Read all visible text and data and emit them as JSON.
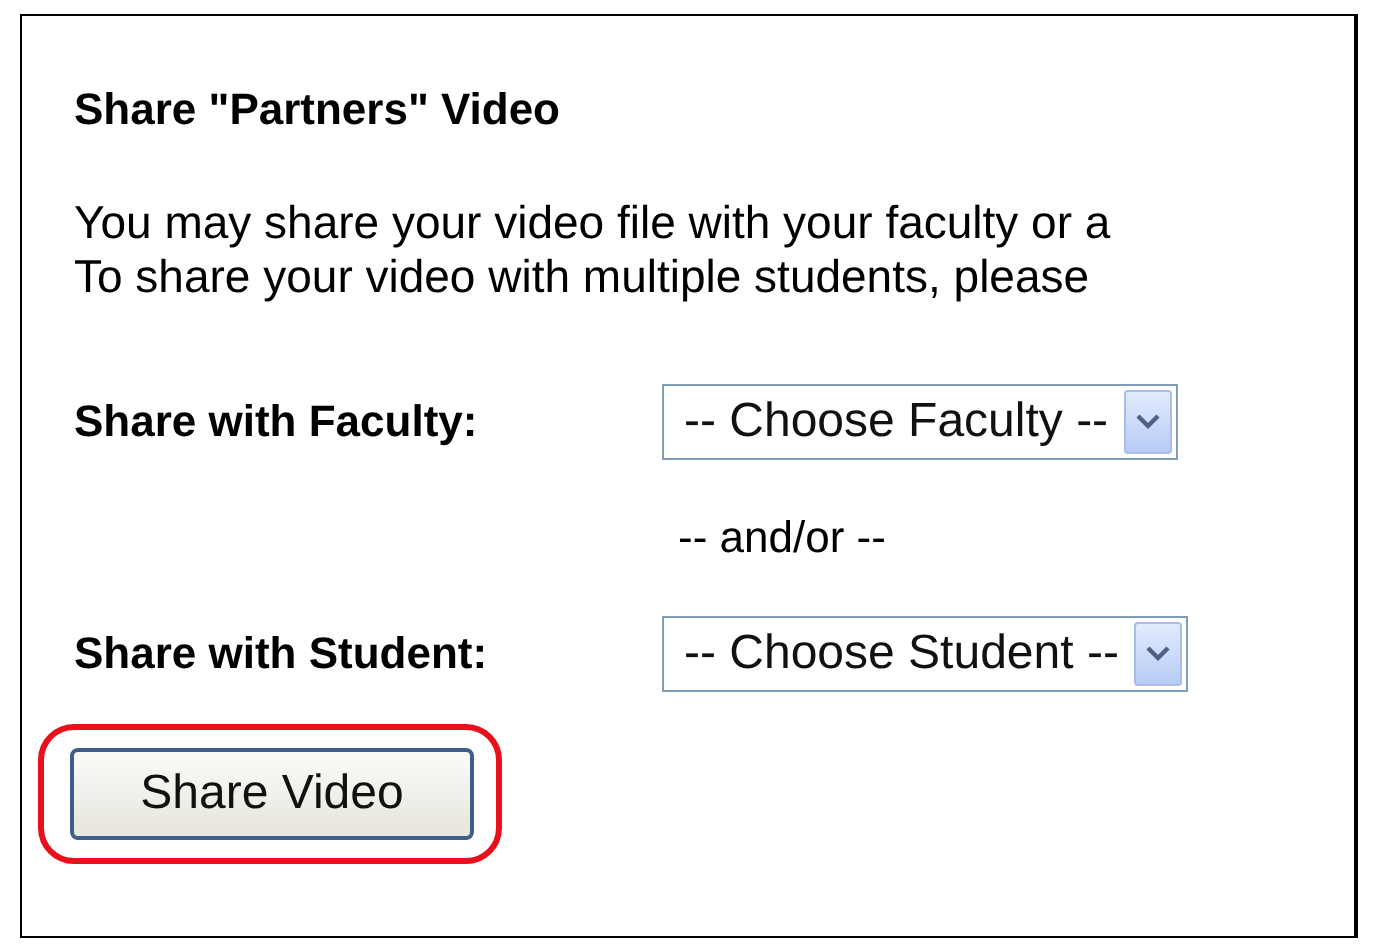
{
  "title": "Share \"Partners\" Video",
  "intro_lines": [
    "You may share your video file with your faculty or a",
    "To share your video with multiple students, please"
  ],
  "fields": [
    {
      "label": "Share with Faculty:",
      "value": "-- Choose Faculty --"
    },
    {
      "label": "Share with Student:",
      "value": "-- Choose Student --"
    }
  ],
  "separator": "-- and/or --",
  "button": {
    "label": "Share Video",
    "highlighted": true
  }
}
